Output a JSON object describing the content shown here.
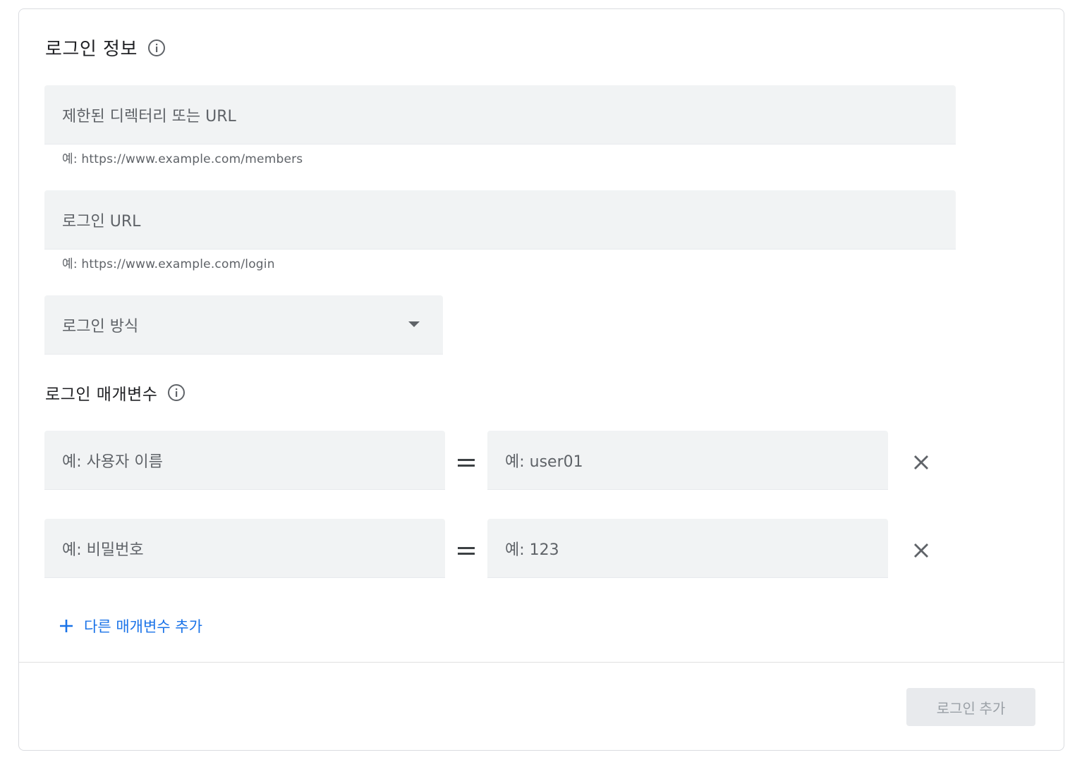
{
  "login_info": {
    "title": "로그인 정보",
    "info_icon": "info-icon",
    "restricted_dir": {
      "placeholder": "제한된 디렉터리 또는 URL",
      "hint": "예: https://www.example.com/members"
    },
    "login_url": {
      "placeholder": "로그인 URL",
      "hint": "예: https://www.example.com/login"
    },
    "login_method": {
      "placeholder": "로그인 방식",
      "icon": "dropdown-arrow-icon"
    }
  },
  "login_params": {
    "title": "로그인 매개변수",
    "info_icon": "info-icon",
    "rows": [
      {
        "key_placeholder": "예: 사용자 이름",
        "value_placeholder": "예: user01"
      },
      {
        "key_placeholder": "예: 비밀번호",
        "value_placeholder": "예: 123"
      }
    ],
    "add_label": "다른 매개변수 추가"
  },
  "footer": {
    "submit_label": "로그인 추가"
  },
  "colors": {
    "accent": "#1a73e8",
    "field_bg": "#f1f3f4",
    "disabled_bg": "#e8eaed"
  }
}
